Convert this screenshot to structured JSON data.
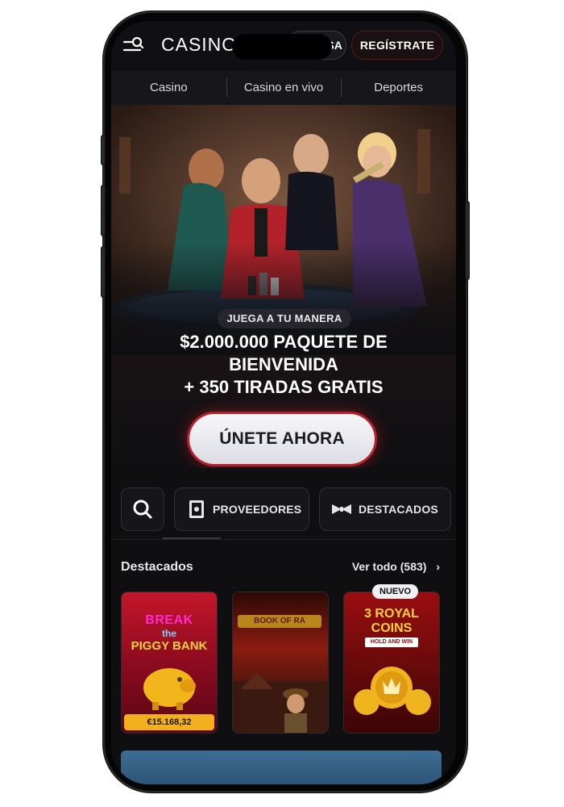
{
  "header": {
    "logo": "CASINOVA",
    "login_label": "INGRESA",
    "register_label": "REGÍSTRATE"
  },
  "nav": {
    "items": [
      {
        "label": "Casino"
      },
      {
        "label": "Casino en vivo"
      },
      {
        "label": "Deportes"
      }
    ]
  },
  "hero": {
    "tagline": "JUEGA A TU MANERA",
    "headline_line1": "$2.000.000 PAQUETE DE",
    "headline_line2": "BIENVENIDA",
    "headline_line3": "+ 350 TIRADAS GRATIS",
    "cta_label": "ÚNETE AHORA"
  },
  "filters": {
    "search_icon": "search-icon",
    "providers_label": "PROVEEDORES",
    "providers_icon": "book-icon",
    "featured_label": "DESTACADOS",
    "featured_icon": "bowtie-icon"
  },
  "section": {
    "title": "Destacados",
    "see_all": "Ver todo (583)"
  },
  "games": [
    {
      "title_top": "BREAK",
      "title_mid": "the",
      "title_bottom": "PIGGY BANK",
      "jackpot": "€15.168,32"
    },
    {
      "title": "BOOK OF RA"
    },
    {
      "badge": "NUEVO",
      "title_top": "3 ROYAL",
      "title_mid": "COINS",
      "subtitle": "HOLD AND WIN"
    }
  ],
  "colors": {
    "accent_red": "#b3202b",
    "jackpot_gold": "#f2b01e",
    "background": "#0f0f12"
  }
}
